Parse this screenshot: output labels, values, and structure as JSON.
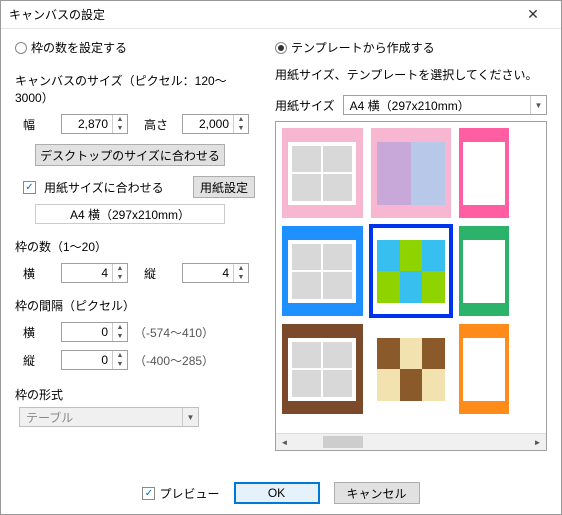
{
  "title": "キャンバスの設定",
  "radios": {
    "frames": "枠の数を設定する",
    "template": "テンプレートから作成する",
    "selected": "template"
  },
  "canvasSize": {
    "title": "キャンバスのサイズ（ピクセル：120～3000）",
    "widthLabel": "幅",
    "width": "2,870",
    "heightLabel": "高さ",
    "height": "2,000",
    "desktopBtn": "デスクトップのサイズに合わせる",
    "fitPaper": "用紙サイズに合わせる",
    "paperBtn": "用紙設定",
    "paperDisplay": "A4 横（297x210mm）"
  },
  "frameCount": {
    "title": "枠の数（1～20）",
    "hLabel": "横",
    "h": "4",
    "vLabel": "縦",
    "v": "4"
  },
  "spacing": {
    "title": "枠の間隔（ピクセル）",
    "hLabel": "横",
    "h": "0",
    "hRange": "（-574～410）",
    "vLabel": "縦",
    "v": "0",
    "vRange": "（-400～285）"
  },
  "frameStyle": {
    "title": "枠の形式",
    "value": "テーブル"
  },
  "templateSide": {
    "instruction": "用紙サイズ、テンプレートを選択してください。",
    "paperSizeLabel": "用紙サイズ",
    "paperSize": "A4 横（297x210mm）"
  },
  "templates": [
    {
      "bg": "#f7b7d0",
      "type": "g4"
    },
    {
      "bg": "#f7b7d0",
      "type": "plain",
      "palette": [
        "#c8a8d8",
        "#b8c8e8"
      ]
    },
    {
      "bg": "#ff5fa2",
      "type": "half"
    },
    {
      "bg": "#1e90ff",
      "type": "g4"
    },
    {
      "bg": "#ffffff",
      "type": "g6",
      "selected": true,
      "palette": [
        "#37bff0",
        "#8fd400",
        "#37bff0",
        "#8fd400",
        "#37bff0",
        "#8fd400"
      ]
    },
    {
      "bg": "#2bb36a",
      "type": "half"
    },
    {
      "bg": "#7a4a2a",
      "type": "g4"
    },
    {
      "bg": "#ffffff",
      "type": "g6",
      "palette": [
        "#8b5a2b",
        "#f2e2b0",
        "#8b5a2b",
        "#f2e2b0",
        "#8b5a2b",
        "#f2e2b0"
      ]
    },
    {
      "bg": "#ff8c1a",
      "type": "half"
    }
  ],
  "footer": {
    "preview": "プレビュー",
    "ok": "OK",
    "cancel": "キャンセル"
  }
}
